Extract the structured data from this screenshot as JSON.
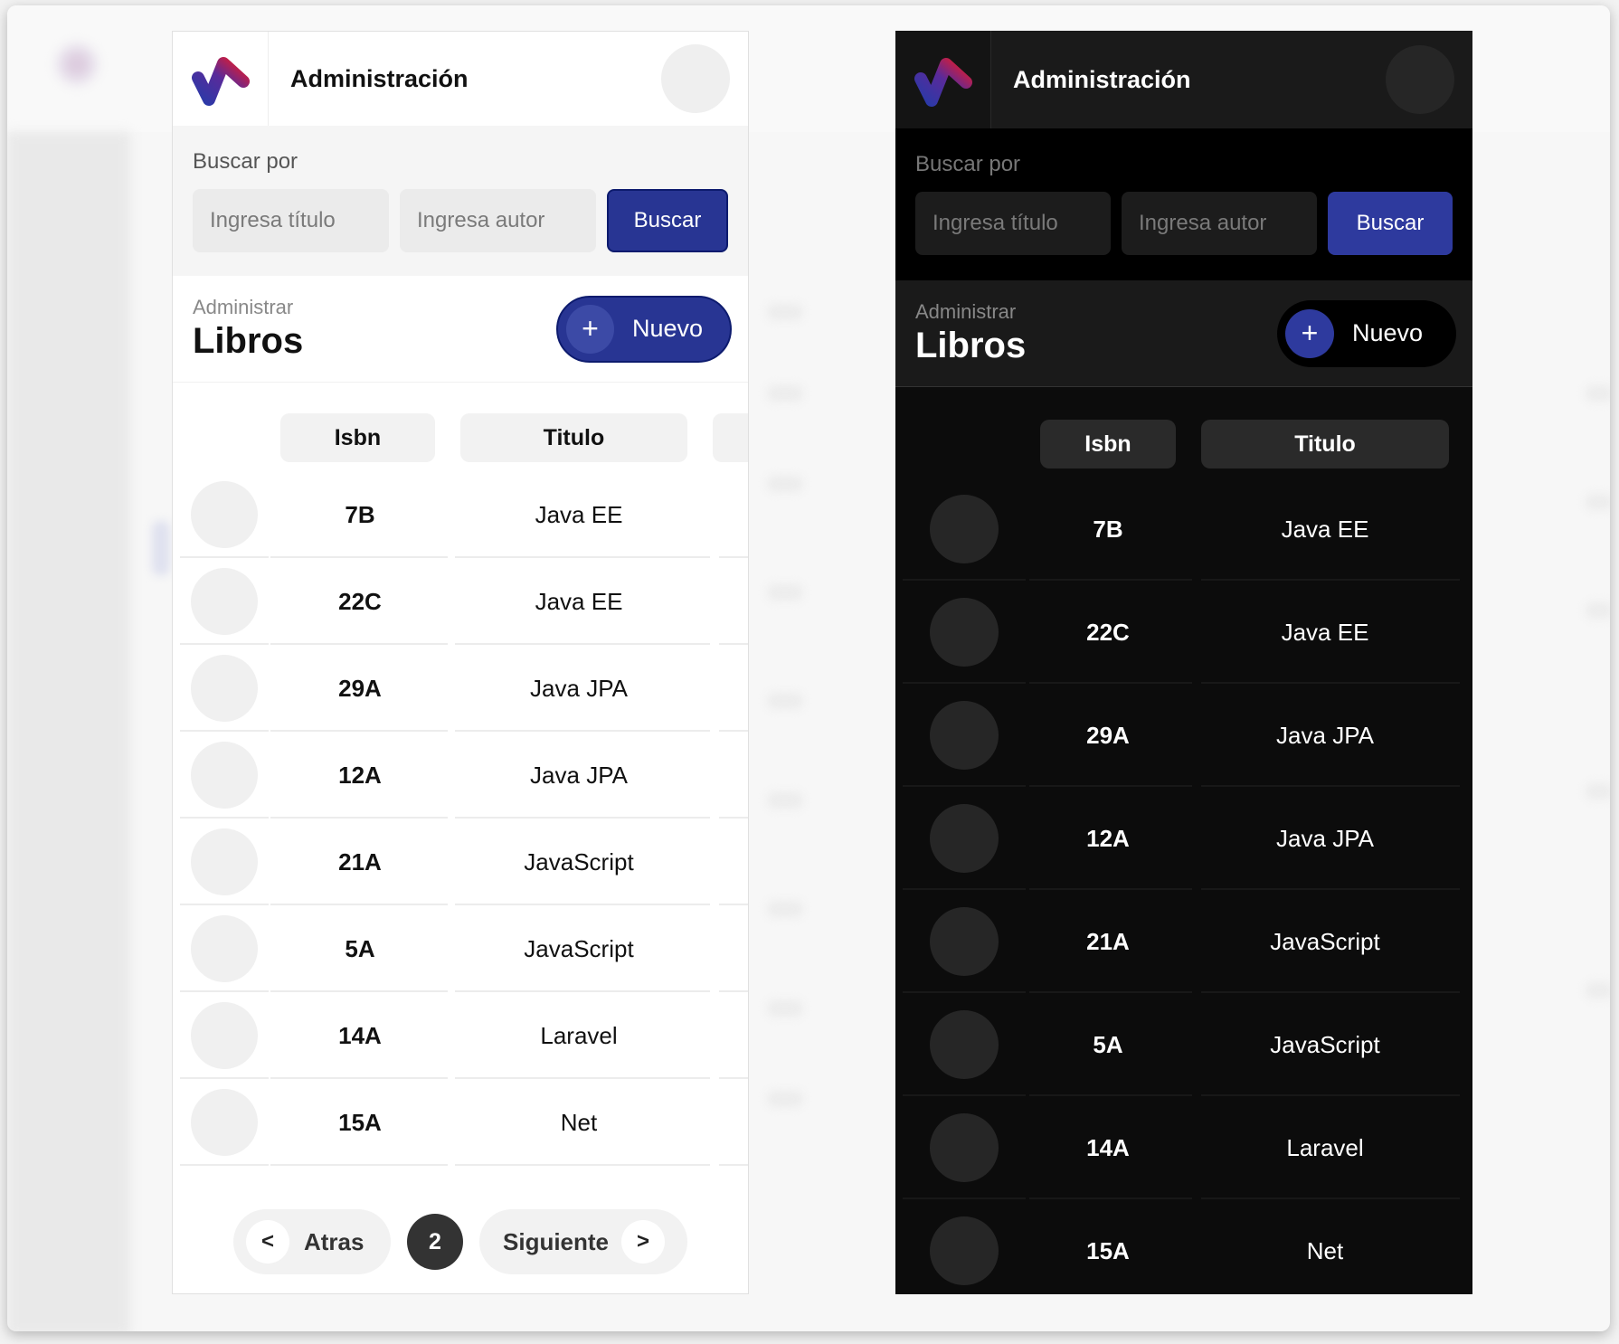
{
  "app": {
    "title": "Administración",
    "search": {
      "label": "Buscar por",
      "title_placeholder": "Ingresa título",
      "author_placeholder": "Ingresa autor",
      "button": "Buscar"
    },
    "section": {
      "subtitle": "Administrar",
      "title": "Libros",
      "new_button": "Nuevo",
      "new_icon": "+"
    },
    "table": {
      "columns": [
        "Isbn",
        "Titulo"
      ],
      "rows": [
        {
          "isbn": "7B",
          "titulo": "Java EE"
        },
        {
          "isbn": "22C",
          "titulo": "Java EE"
        },
        {
          "isbn": "29A",
          "titulo": "Java JPA"
        },
        {
          "isbn": "12A",
          "titulo": "Java JPA"
        },
        {
          "isbn": "21A",
          "titulo": "JavaScript"
        },
        {
          "isbn": "5A",
          "titulo": "JavaScript"
        },
        {
          "isbn": "14A",
          "titulo": "Laravel"
        },
        {
          "isbn": "15A",
          "titulo": "Net"
        }
      ]
    },
    "pager": {
      "prev_icon": "<",
      "prev": "Atras",
      "page": "2",
      "next": "Siguiente",
      "next_icon": ">"
    }
  },
  "colors": {
    "primary": "#283593",
    "logo_red": "#e21b2d",
    "logo_blue": "#2a3aa8"
  }
}
